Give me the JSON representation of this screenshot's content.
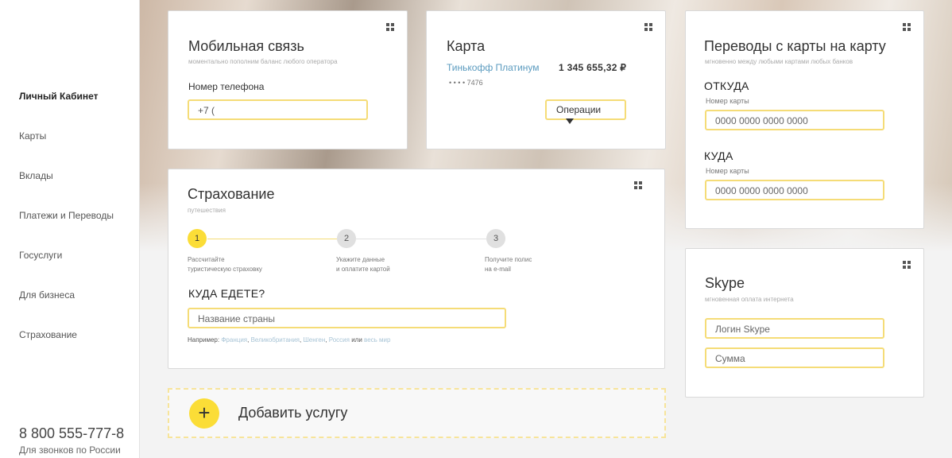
{
  "sidebar": {
    "items": [
      {
        "label": "Личный Кабинет"
      },
      {
        "label": "Карты"
      },
      {
        "label": "Вклады"
      },
      {
        "label": "Платежи и Переводы"
      },
      {
        "label": "Госуслуги"
      },
      {
        "label": "Для бизнеса"
      },
      {
        "label": "Страхование"
      }
    ],
    "phone": "8 800 555-777-8",
    "phone_note": "Для звонков по России"
  },
  "mobile": {
    "title": "Мобильная связь",
    "subtitle": "моментально пополним баланс любого оператора",
    "phone_label": "Номер телефона",
    "phone_value": "+7 ("
  },
  "card": {
    "title": "Карта",
    "card_name": "Тинькофф Платинум",
    "balance": "1 345 655,32 ₽",
    "masked_number": "• • • • 7476",
    "operations_label": "Операции"
  },
  "transfers": {
    "title": "Переводы с карты на карту",
    "subtitle": "мгновенно между любыми картами любых банков",
    "from_label": "ОТКУДА",
    "from_card_label": "Номер карты",
    "from_placeholder": "0000 0000 0000 0000",
    "to_label": "КУДА",
    "to_card_label": "Номер карты",
    "to_placeholder": "0000 0000 0000 0000"
  },
  "insurance": {
    "title": "Страхование",
    "subtitle": "путешествия",
    "steps": [
      {
        "num": "1",
        "line1": "Рассчитайте",
        "line2": "туристическую страховку"
      },
      {
        "num": "2",
        "line1": "Укажите данные",
        "line2": "и оплатите картой"
      },
      {
        "num": "3",
        "line1": "Получите полис",
        "line2": "на e-mail"
      }
    ],
    "question": "КУДА ЕДЕТЕ?",
    "country_placeholder": "Название страны",
    "examples_prefix": "Например:",
    "examples": [
      "Франция",
      "Великобритания",
      "Шенген",
      "Россия"
    ],
    "examples_or": "или",
    "examples_last": "весь мир"
  },
  "skype": {
    "title": "Skype",
    "subtitle": "мгновенная оплата интернета",
    "login_placeholder": "Логин Skype",
    "amount_placeholder": "Сумма"
  },
  "add_service": {
    "plus": "+",
    "label": "Добавить услугу"
  },
  "colors": {
    "accent_yellow": "#fbdd37",
    "input_border": "#f5dc77",
    "link_blue": "#5b9bbf"
  }
}
